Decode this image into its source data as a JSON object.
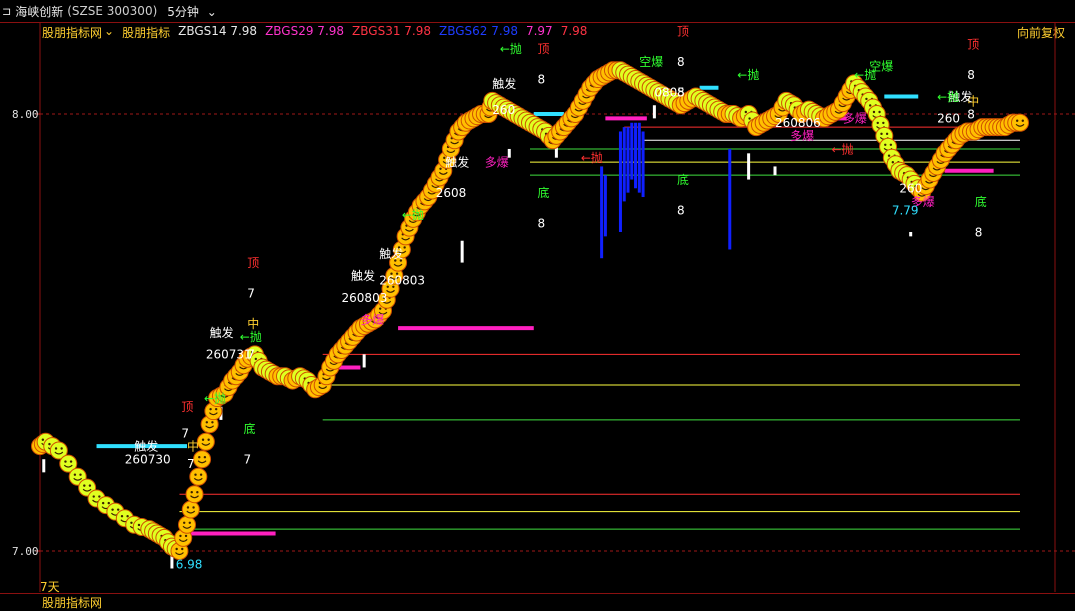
{
  "header": {
    "icon": "collapse-icon",
    "stock_name": "海峡创新",
    "code": "(SZSE 300300)",
    "period": "5分钟",
    "period_icon": "chevron-down-icon"
  },
  "indicator_legend": [
    {
      "text": "股朋指标网",
      "color": "#ffcf30",
      "dropdown": true
    },
    {
      "text": "股朋指标",
      "color": "#ffcf30"
    },
    {
      "text": "ZBGS14 7.98",
      "color": "#e8e8e8"
    },
    {
      "text": "ZBGS29 7.98",
      "color": "#ff33cc"
    },
    {
      "text": "ZBGS31 7.98",
      "color": "#ff3344"
    },
    {
      "text": "ZBGS62 7.98",
      "color": "#1e3cff"
    },
    {
      "text": "7.97",
      "color": "#ff33cc"
    },
    {
      "text": "7.98",
      "color": "#ff3344"
    }
  ],
  "fuquan_button": "向前复权",
  "bottom_period": "7天",
  "subpanel_title": "股朋指标网",
  "colors": {
    "rise": "#ffc000",
    "fall": "#e0ff20",
    "top": "#ff3030",
    "bottom": "#30ff30",
    "white": "#ffffff",
    "magenta": "#ff20c0",
    "cyan": "#30e0ff",
    "blue": "#1020ff"
  },
  "chart_data": {
    "type": "line",
    "yaxis_ticks": [
      "8.00",
      "7.00"
    ],
    "ylim": [
      6.96,
      8.15
    ],
    "price_path": [
      [
        0,
        7.24
      ],
      [
        3,
        7.25
      ],
      [
        10,
        7.23
      ],
      [
        20,
        7.17
      ],
      [
        30,
        7.12
      ],
      [
        40,
        7.09
      ],
      [
        50,
        7.06
      ],
      [
        58,
        7.05
      ],
      [
        62,
        7.04
      ],
      [
        66,
        7.03
      ],
      [
        70,
        7.01
      ],
      [
        74,
        7.0
      ],
      [
        78,
        7.06
      ],
      [
        82,
        7.13
      ],
      [
        86,
        7.21
      ],
      [
        90,
        7.29
      ],
      [
        94,
        7.35
      ],
      [
        98,
        7.36
      ],
      [
        102,
        7.39
      ],
      [
        106,
        7.41
      ],
      [
        110,
        7.44
      ],
      [
        114,
        7.45
      ],
      [
        118,
        7.42
      ],
      [
        122,
        7.41
      ],
      [
        126,
        7.4
      ],
      [
        130,
        7.4
      ],
      [
        134,
        7.39
      ],
      [
        138,
        7.4
      ],
      [
        142,
        7.39
      ],
      [
        146,
        7.37
      ],
      [
        150,
        7.38
      ],
      [
        154,
        7.42
      ],
      [
        158,
        7.45
      ],
      [
        162,
        7.47
      ],
      [
        166,
        7.49
      ],
      [
        170,
        7.51
      ],
      [
        174,
        7.52
      ],
      [
        178,
        7.53
      ],
      [
        182,
        7.55
      ],
      [
        186,
        7.6
      ],
      [
        190,
        7.66
      ],
      [
        194,
        7.72
      ],
      [
        198,
        7.76
      ],
      [
        202,
        7.79
      ],
      [
        206,
        7.81
      ],
      [
        210,
        7.84
      ],
      [
        214,
        7.87
      ],
      [
        218,
        7.92
      ],
      [
        222,
        7.96
      ],
      [
        226,
        7.98
      ],
      [
        230,
        7.99
      ],
      [
        234,
        8.0
      ],
      [
        238,
        8.0
      ],
      [
        240,
        8.03
      ],
      [
        244,
        8.02
      ],
      [
        248,
        8.01
      ],
      [
        252,
        8.0
      ],
      [
        256,
        7.99
      ],
      [
        260,
        7.98
      ],
      [
        264,
        7.97
      ],
      [
        268,
        7.96
      ],
      [
        272,
        7.94
      ],
      [
        276,
        7.96
      ],
      [
        280,
        7.98
      ],
      [
        284,
        8.0
      ],
      [
        288,
        8.03
      ],
      [
        292,
        8.06
      ],
      [
        296,
        8.08
      ],
      [
        300,
        8.09
      ],
      [
        304,
        8.1
      ],
      [
        308,
        8.1
      ],
      [
        312,
        8.09
      ],
      [
        316,
        8.08
      ],
      [
        320,
        8.07
      ],
      [
        324,
        8.06
      ],
      [
        328,
        8.05
      ],
      [
        332,
        8.04
      ],
      [
        336,
        8.03
      ],
      [
        340,
        8.02
      ],
      [
        344,
        8.03
      ],
      [
        348,
        8.04
      ],
      [
        352,
        8.03
      ],
      [
        356,
        8.02
      ],
      [
        360,
        8.01
      ],
      [
        364,
        8.0
      ],
      [
        368,
        8.0
      ],
      [
        372,
        7.99
      ],
      [
        376,
        8.0
      ],
      [
        380,
        7.97
      ],
      [
        384,
        7.98
      ],
      [
        388,
        7.99
      ],
      [
        392,
        8.0
      ],
      [
        396,
        8.03
      ],
      [
        400,
        8.02
      ],
      [
        404,
        8.0
      ],
      [
        408,
        8.01
      ],
      [
        412,
        8.0
      ],
      [
        416,
        7.99
      ],
      [
        420,
        8.0
      ],
      [
        424,
        8.01
      ],
      [
        428,
        8.04
      ],
      [
        432,
        8.07
      ],
      [
        436,
        8.05
      ],
      [
        440,
        8.03
      ],
      [
        444,
        8.0
      ],
      [
        448,
        7.95
      ],
      [
        452,
        7.9
      ],
      [
        456,
        7.87
      ],
      [
        460,
        7.86
      ],
      [
        464,
        7.84
      ],
      [
        468,
        7.82
      ],
      [
        472,
        7.85
      ],
      [
        476,
        7.88
      ],
      [
        480,
        7.91
      ],
      [
        484,
        7.93
      ],
      [
        488,
        7.95
      ],
      [
        492,
        7.96
      ],
      [
        496,
        7.96
      ],
      [
        500,
        7.97
      ],
      [
        504,
        7.97
      ],
      [
        508,
        7.97
      ],
      [
        512,
        7.97
      ],
      [
        516,
        7.98
      ],
      [
        520,
        7.98
      ]
    ],
    "horizontal_levels": [
      {
        "y": 7.45,
        "color": "#ff3030",
        "x_start": 150
      },
      {
        "y": 7.38,
        "color": "#ffff40",
        "x_start": 150
      },
      {
        "y": 7.3,
        "color": "#40e040",
        "x_start": 150
      },
      {
        "y": 7.13,
        "color": "#ff3030",
        "x_start": 74
      },
      {
        "y": 7.09,
        "color": "#ffff40",
        "x_start": 74
      },
      {
        "y": 7.05,
        "color": "#40e040",
        "x_start": 74
      },
      {
        "y": 7.97,
        "color": "#ff3030",
        "x_start": 310
      },
      {
        "y": 7.94,
        "color": "#ffffff",
        "x_start": 320
      },
      {
        "y": 7.92,
        "color": "#40e040",
        "x_start": 260
      },
      {
        "y": 7.89,
        "color": "#ffff40",
        "x_start": 260
      },
      {
        "y": 7.86,
        "color": "#40e040",
        "x_start": 260
      }
    ],
    "dashed_levels": [
      8.0,
      7.0
    ],
    "annotations": [
      {
        "x": 50,
        "y": 7.23,
        "text": "触发",
        "color": "#ffffff"
      },
      {
        "x": 45,
        "y": 7.2,
        "text": "260730",
        "color": "#ffffff"
      },
      {
        "x": 78,
        "y": 7.23,
        "text": "中",
        "color": "#ffcf30"
      },
      {
        "x": 78,
        "y": 7.19,
        "text": "7",
        "color": "#ffffff"
      },
      {
        "x": 75,
        "y": 7.32,
        "text": "顶",
        "color": "#ff3030"
      },
      {
        "x": 75,
        "y": 7.26,
        "text": "7",
        "color": "#ffffff"
      },
      {
        "x": 87,
        "y": 7.34,
        "text": "←抛",
        "color": "#30ff30"
      },
      {
        "x": 108,
        "y": 7.27,
        "text": "底",
        "color": "#30ff30"
      },
      {
        "x": 108,
        "y": 7.2,
        "text": "7",
        "color": "#ffffff"
      },
      {
        "x": 90,
        "y": 7.49,
        "text": "触发",
        "color": "#ffffff"
      },
      {
        "x": 88,
        "y": 7.44,
        "text": "260731",
        "color": "#ffffff"
      },
      {
        "x": 110,
        "y": 7.65,
        "text": "顶",
        "color": "#ff3030"
      },
      {
        "x": 110,
        "y": 7.58,
        "text": "7",
        "color": "#ffffff"
      },
      {
        "x": 110,
        "y": 7.51,
        "text": "中",
        "color": "#ffcf30"
      },
      {
        "x": 106,
        "y": 7.48,
        "text": "←抛",
        "color": "#30ff30"
      },
      {
        "x": 110,
        "y": 7.44,
        "text": "7",
        "color": "#ffffff"
      },
      {
        "x": 165,
        "y": 7.62,
        "text": "触发",
        "color": "#ffffff"
      },
      {
        "x": 160,
        "y": 7.57,
        "text": "260803",
        "color": "#ffffff"
      },
      {
        "x": 180,
        "y": 7.67,
        "text": "触发",
        "color": "#ffffff"
      },
      {
        "x": 180,
        "y": 7.61,
        "text": "260803",
        "color": "#ffffff"
      },
      {
        "x": 170,
        "y": 7.52,
        "text": "多爆",
        "color": "#ff20c0"
      },
      {
        "x": 215,
        "y": 7.88,
        "text": "触发",
        "color": "#ffffff"
      },
      {
        "x": 210,
        "y": 7.81,
        "text": "2608",
        "color": "#ffffff"
      },
      {
        "x": 236,
        "y": 7.88,
        "text": "多爆",
        "color": "#ff20c0"
      },
      {
        "x": 192,
        "y": 7.76,
        "text": "←抛",
        "color": "#30ff30"
      },
      {
        "x": 240,
        "y": 8.06,
        "text": "触发",
        "color": "#ffffff"
      },
      {
        "x": 240,
        "y": 8.0,
        "text": "260",
        "color": "#ffffff"
      },
      {
        "x": 244,
        "y": 8.14,
        "text": "←抛",
        "color": "#30ff30"
      },
      {
        "x": 264,
        "y": 8.14,
        "text": "顶",
        "color": "#ff3030"
      },
      {
        "x": 264,
        "y": 8.07,
        "text": "8",
        "color": "#ffffff"
      },
      {
        "x": 264,
        "y": 7.81,
        "text": "底",
        "color": "#30ff30"
      },
      {
        "x": 264,
        "y": 7.74,
        "text": "8",
        "color": "#ffffff"
      },
      {
        "x": 338,
        "y": 8.18,
        "text": "顶",
        "color": "#ff3030"
      },
      {
        "x": 338,
        "y": 8.11,
        "text": "8",
        "color": "#ffffff"
      },
      {
        "x": 338,
        "y": 8.04,
        "text": "8",
        "color": "#ffffff"
      },
      {
        "x": 338,
        "y": 7.84,
        "text": "底",
        "color": "#30ff30"
      },
      {
        "x": 338,
        "y": 7.77,
        "text": "8",
        "color": "#ffffff"
      },
      {
        "x": 318,
        "y": 8.11,
        "text": "空爆",
        "color": "#30ff30"
      },
      {
        "x": 326,
        "y": 8.04,
        "text": "0805",
        "color": "#ffffff"
      },
      {
        "x": 370,
        "y": 8.08,
        "text": "←抛",
        "color": "#30ff30"
      },
      {
        "x": 390,
        "y": 7.97,
        "text": "260806",
        "color": "#ffffff"
      },
      {
        "x": 398,
        "y": 7.94,
        "text": "多爆",
        "color": "#ff20c0"
      },
      {
        "x": 426,
        "y": 7.98,
        "text": "多爆",
        "color": "#ff20c0"
      },
      {
        "x": 440,
        "y": 8.1,
        "text": "空爆",
        "color": "#30ff30"
      },
      {
        "x": 432,
        "y": 8.08,
        "text": "←抛",
        "color": "#30ff30"
      },
      {
        "x": 492,
        "y": 8.15,
        "text": "顶",
        "color": "#ff3030"
      },
      {
        "x": 492,
        "y": 8.08,
        "text": "8",
        "color": "#ffffff"
      },
      {
        "x": 492,
        "y": 8.02,
        "text": "中",
        "color": "#ffcf30"
      },
      {
        "x": 492,
        "y": 7.99,
        "text": "8",
        "color": "#ffffff"
      },
      {
        "x": 482,
        "y": 8.03,
        "text": "触发",
        "color": "#ffffff"
      },
      {
        "x": 476,
        "y": 7.98,
        "text": "260",
        "color": "#ffffff"
      },
      {
        "x": 476,
        "y": 8.03,
        "text": "←抛",
        "color": "#30ff30"
      },
      {
        "x": 456,
        "y": 7.82,
        "text": "260",
        "color": "#ffffff"
      },
      {
        "x": 462,
        "y": 7.79,
        "text": "多爆",
        "color": "#ff20c0"
      },
      {
        "x": 496,
        "y": 7.79,
        "text": "底",
        "color": "#30ff30"
      },
      {
        "x": 496,
        "y": 7.72,
        "text": "8",
        "color": "#ffffff"
      },
      {
        "x": 420,
        "y": 7.91,
        "text": "←抛",
        "color": "#ff3030"
      },
      {
        "x": 287,
        "y": 7.89,
        "text": "←抛",
        "color": "#ff3030"
      },
      {
        "x": 72,
        "y": 6.96,
        "text": "6.98",
        "color": "#30e0ff"
      },
      {
        "x": 452,
        "y": 7.77,
        "text": "7.79",
        "color": "#30e0ff"
      }
    ],
    "magenta_segments": [
      {
        "x1": 76,
        "x2": 125,
        "y": 7.04
      },
      {
        "x1": 190,
        "x2": 262,
        "y": 7.51
      },
      {
        "x1": 300,
        "x2": 322,
        "y": 7.99
      },
      {
        "x1": 480,
        "x2": 506,
        "y": 7.87
      },
      {
        "x1": 150,
        "x2": 170,
        "y": 7.42
      },
      {
        "x1": 416,
        "x2": 428,
        "y": 7.99
      }
    ],
    "cyan_segments": [
      {
        "x1": 30,
        "x2": 78,
        "y": 7.24
      },
      {
        "x1": 262,
        "x2": 278,
        "y": 8.0
      },
      {
        "x1": 350,
        "x2": 360,
        "y": 8.06
      },
      {
        "x1": 448,
        "x2": 466,
        "y": 8.04
      },
      {
        "x1": 130,
        "x2": 140,
        "y": 7.39
      }
    ],
    "blue_bars": [
      {
        "x": 298,
        "top": 7.88,
        "bottom": 7.67
      },
      {
        "x": 300,
        "top": 7.86,
        "bottom": 7.72
      },
      {
        "x": 308,
        "top": 7.96,
        "bottom": 7.73
      },
      {
        "x": 310,
        "top": 7.97,
        "bottom": 7.8
      },
      {
        "x": 312,
        "top": 7.97,
        "bottom": 7.82
      },
      {
        "x": 314,
        "top": 7.98,
        "bottom": 7.85
      },
      {
        "x": 316,
        "top": 7.98,
        "bottom": 7.83
      },
      {
        "x": 318,
        "top": 7.98,
        "bottom": 7.82
      },
      {
        "x": 320,
        "top": 7.96,
        "bottom": 7.81
      },
      {
        "x": 366,
        "top": 7.92,
        "bottom": 7.69
      }
    ],
    "white_bars": [
      {
        "x": 2,
        "top": 7.21,
        "bottom": 7.18
      },
      {
        "x": 70,
        "top": 7.0,
        "bottom": 6.96
      },
      {
        "x": 96,
        "top": 7.33,
        "bottom": 7.3
      },
      {
        "x": 172,
        "top": 7.45,
        "bottom": 7.42
      },
      {
        "x": 224,
        "top": 7.71,
        "bottom": 7.66
      },
      {
        "x": 249,
        "top": 7.92,
        "bottom": 7.9
      },
      {
        "x": 274,
        "top": 7.95,
        "bottom": 7.9
      },
      {
        "x": 326,
        "top": 8.02,
        "bottom": 7.99
      },
      {
        "x": 376,
        "top": 7.91,
        "bottom": 7.85
      },
      {
        "x": 390,
        "top": 7.88,
        "bottom": 7.86
      },
      {
        "x": 462,
        "top": 7.73,
        "bottom": 7.72
      }
    ]
  }
}
